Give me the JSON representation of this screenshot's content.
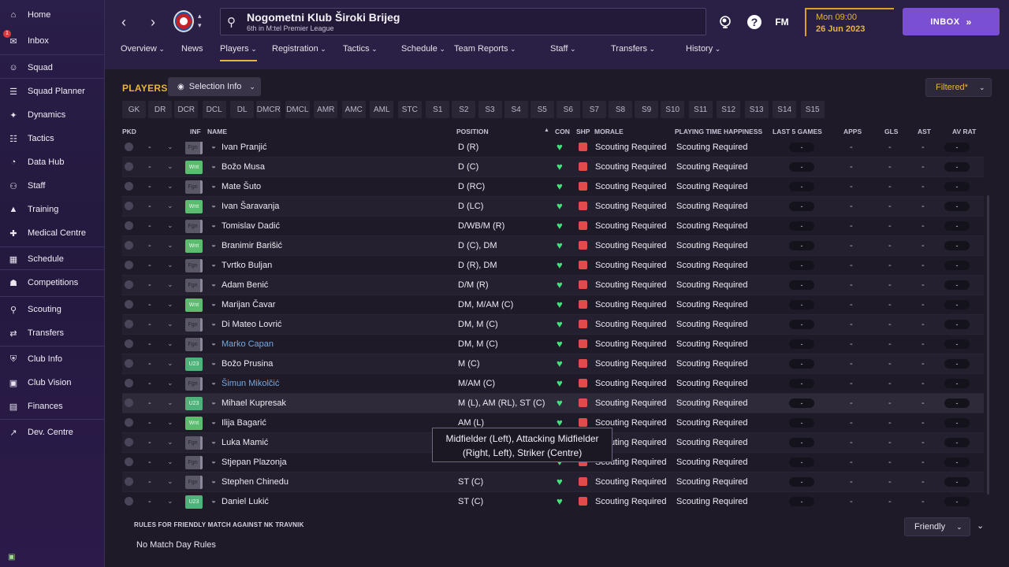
{
  "sidebar": {
    "items": [
      {
        "label": "Home",
        "icon": "home-icon"
      },
      {
        "label": "Inbox",
        "icon": "inbox-icon"
      },
      {
        "label": "Squad",
        "icon": "squad-icon"
      },
      {
        "label": "Squad Planner",
        "icon": "clipboard-icon"
      },
      {
        "label": "Dynamics",
        "icon": "dynamics-icon"
      },
      {
        "label": "Tactics",
        "icon": "tactics-icon"
      },
      {
        "label": "Data Hub",
        "icon": "data-hub-icon"
      },
      {
        "label": "Staff",
        "icon": "staff-icon"
      },
      {
        "label": "Training",
        "icon": "training-icon"
      },
      {
        "label": "Medical Centre",
        "icon": "medical-icon"
      },
      {
        "label": "Schedule",
        "icon": "calendar-icon"
      },
      {
        "label": "Competitions",
        "icon": "trophy-icon"
      },
      {
        "label": "Scouting",
        "icon": "scouting-icon"
      },
      {
        "label": "Transfers",
        "icon": "transfers-icon"
      },
      {
        "label": "Club Info",
        "icon": "shield-icon"
      },
      {
        "label": "Club Vision",
        "icon": "briefcase-icon"
      },
      {
        "label": "Finances",
        "icon": "money-icon"
      },
      {
        "label": "Dev. Centre",
        "icon": "dev-centre-icon"
      }
    ],
    "inbox_badge": "1"
  },
  "header": {
    "club_name": "Nogometni Klub Široki Brijeg",
    "club_subtitle": "6th in M:tel Premier League",
    "fm_label": "FM",
    "help_label": "?",
    "date_line1": "Mon 09:00",
    "date_line2": "26 Jun 2023",
    "inbox_button": "INBOX"
  },
  "tabs": [
    {
      "label": "Overview",
      "dropdown": true
    },
    {
      "label": "News",
      "dropdown": false
    },
    {
      "label": "Players",
      "dropdown": true,
      "active": true
    },
    {
      "label": "Registration",
      "dropdown": true
    },
    {
      "label": "Tactics",
      "dropdown": true
    },
    {
      "label": "Schedule",
      "dropdown": true
    },
    {
      "label": "Team Reports",
      "dropdown": true
    },
    {
      "label": "Staff",
      "dropdown": true
    },
    {
      "label": "Transfers",
      "dropdown": true
    },
    {
      "label": "History",
      "dropdown": true
    }
  ],
  "main": {
    "title": "PLAYERS",
    "selection_info": "Selection Info",
    "filtered": "Filtered*",
    "position_filters": [
      "GK",
      "DR",
      "DCR",
      "DCL",
      "DL",
      "DMCR",
      "DMCL",
      "AMR",
      "AMC",
      "AML",
      "STC",
      "S1",
      "S2",
      "S3",
      "S4",
      "S5",
      "S6",
      "S7",
      "S8",
      "S9",
      "S10",
      "S11",
      "S12",
      "S13",
      "S14",
      "S15"
    ],
    "columns": [
      "PKD",
      "INF",
      "NAME",
      "POSITION",
      "CON",
      "SHP",
      "MORALE",
      "PLAYING TIME HAPPINESS",
      "LAST 5 GAMES",
      "APPS",
      "GLS",
      "AST",
      "AV RAT"
    ],
    "rows": [
      {
        "inf": "Fgn",
        "name": "Ivan Pranjić",
        "position": "D (R)",
        "morale": "Scouting Required",
        "pth": "Scouting Required",
        "link": false
      },
      {
        "inf": "Wnt",
        "name": "Božo Musa",
        "position": "D (C)",
        "morale": "Scouting Required",
        "pth": "Scouting Required",
        "link": false
      },
      {
        "inf": "Fgn",
        "name": "Mate Šuto",
        "position": "D (RC)",
        "morale": "Scouting Required",
        "pth": "Scouting Required",
        "link": false
      },
      {
        "inf": "Wnt",
        "name": "Ivan Šaravanja",
        "position": "D (LC)",
        "morale": "Scouting Required",
        "pth": "Scouting Required",
        "link": false
      },
      {
        "inf": "Fgn",
        "name": "Tomislav Dadić",
        "position": "D/WB/M (R)",
        "morale": "Scouting Required",
        "pth": "Scouting Required",
        "link": false
      },
      {
        "inf": "Wnt",
        "name": "Branimir Barišić",
        "position": "D (C), DM",
        "morale": "Scouting Required",
        "pth": "Scouting Required",
        "link": false
      },
      {
        "inf": "Fgn",
        "name": "Tvrtko Buljan",
        "position": "D (R), DM",
        "morale": "Scouting Required",
        "pth": "Scouting Required",
        "link": false
      },
      {
        "inf": "Fgn",
        "name": "Adam Benić",
        "position": "D/M (R)",
        "morale": "Scouting Required",
        "pth": "Scouting Required",
        "link": false
      },
      {
        "inf": "Wnt",
        "name": "Marijan Čavar",
        "position": "DM, M/AM (C)",
        "morale": "Scouting Required",
        "pth": "Scouting Required",
        "link": false
      },
      {
        "inf": "Fgn",
        "name": "Di Mateo Lovrić",
        "position": "DM, M (C)",
        "morale": "Scouting Required",
        "pth": "Scouting Required",
        "link": false
      },
      {
        "inf": "Fgn",
        "name": "Marko Capan",
        "position": "DM, M (C)",
        "morale": "Scouting Required",
        "pth": "Scouting Required",
        "link": true
      },
      {
        "inf": "U23",
        "name": "Božo Prusina",
        "position": "M (C)",
        "morale": "Scouting Required",
        "pth": "Scouting Required",
        "link": false
      },
      {
        "inf": "Fgn",
        "name": "Šimun Mikolčić",
        "position": "M/AM (C)",
        "morale": "Scouting Required",
        "pth": "Scouting Required",
        "link": true
      },
      {
        "inf": "U23",
        "name": "Mihael Kupresak",
        "position": "M (L), AM (RL), ST (C)",
        "morale": "Scouting Required",
        "pth": "Scouting Required",
        "link": false
      },
      {
        "inf": "Wnt",
        "name": "Ilija Bagarić",
        "position": "AM (L)",
        "morale": "Scouting Required",
        "pth": "Scouting Required",
        "link": false
      },
      {
        "inf": "Fgn",
        "name": "Luka Mamić",
        "position": "",
        "morale": "Scouting Required",
        "pth": "Scouting Required",
        "link": false
      },
      {
        "inf": "Fgn",
        "name": "Stjepan Plazonja",
        "position": "",
        "morale": "Scouting Required",
        "pth": "Scouting Required",
        "link": false
      },
      {
        "inf": "Fgn",
        "name": "Stephen Chinedu",
        "position": "ST (C)",
        "morale": "Scouting Required",
        "pth": "Scouting Required",
        "link": false
      },
      {
        "inf": "U23",
        "name": "Daniel Lukić",
        "position": "ST (C)",
        "morale": "Scouting Required",
        "pth": "Scouting Required",
        "link": false
      }
    ],
    "empty_value": "-",
    "tooltip": "Midfielder (Left), Attacking Midfielder (Right, Left), Striker (Centre)"
  },
  "rules": {
    "title": "RULES FOR FRIENDLY MATCH AGAINST NK TRAVNIK",
    "text": "No Match Day Rules",
    "dropdown": "Friendly"
  },
  "colors": {
    "accent": "#e8b53a",
    "inbox": "#7b4fd1",
    "condition": "#3ee37a",
    "sharpness": "#e24b4b",
    "link": "#74a9e0"
  }
}
